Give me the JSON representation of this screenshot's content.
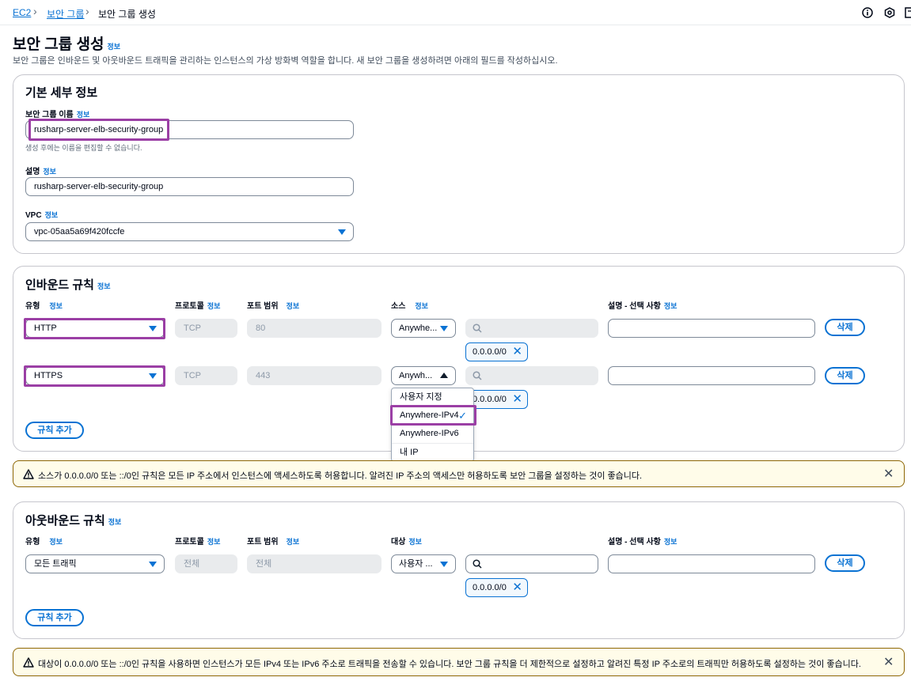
{
  "breadcrumb": {
    "root": "EC2",
    "parent": "보안 그룹",
    "current": "보안 그룹 생성"
  },
  "header": {
    "title": "보안 그룹 생성",
    "info": "정보",
    "description": "보안 그룹은 인바운드 및 아웃바운드 트래픽을 관리하는 인스턴스의 가상 방화벽 역할을 합니다. 새 보안 그룹을 생성하려면 아래의 필드를 작성하십시오."
  },
  "basic": {
    "title": "기본 세부 정보",
    "name_label": "보안 그룹 이름",
    "name_value": "rusharp-server-elb-security-group",
    "name_hint": "생성 후에는 이름을 편집할 수 없습니다.",
    "desc_label": "설명",
    "desc_value": "rusharp-server-elb-security-group",
    "vpc_label": "VPC",
    "vpc_value": "vpc-05aa5a69f420fccfe"
  },
  "inbound": {
    "title": "인바운드 규칙",
    "col_type": "유형",
    "col_protocol": "프로토콜",
    "col_port": "포트 범위",
    "col_source": "소스",
    "col_desc": "설명 - 선택 사항",
    "rows": [
      {
        "type": "HTTP",
        "protocol": "TCP",
        "port": "80",
        "source": "Anywhe...",
        "cidr": "0.0.0.0/0",
        "delete": "삭제"
      },
      {
        "type": "HTTPS",
        "protocol": "TCP",
        "port": "443",
        "source": "Anywh...",
        "cidr": "0.0.0.0/0",
        "delete": "삭제"
      }
    ],
    "add_rule": "규칙 추가",
    "dropdown": [
      "사용자 지정",
      "Anywhere-IPv4",
      "Anywhere-IPv6",
      "내 IP"
    ]
  },
  "inbound_warning": "소스가 0.0.0.0/0 또는 ::/0인 규칙은 모든 IP 주소에서 인스턴스에 액세스하도록 허용합니다. 알려진 IP 주소의 액세스만 허용하도록 보안 그룹을 설정하는 것이 좋습니다.",
  "outbound": {
    "title": "아웃바운드 규칙",
    "col_type": "유형",
    "col_protocol": "프로토콜",
    "col_port": "포트 범위",
    "col_dest": "대상",
    "col_desc": "설명 - 선택 사항",
    "row": {
      "type": "모든 트래픽",
      "protocol": "전체",
      "port": "전체",
      "dest": "사용자 ...",
      "cidr": "0.0.0.0/0",
      "delete": "삭제"
    },
    "add_rule": "규칙 추가"
  },
  "outbound_warning": "대상이 0.0.0.0/0 또는 ::/0인 규칙을 사용하면 인스턴스가 모든 IPv4 또는 IPv6 주소로 트래픽을 전송할 수 있습니다. 보안 그룹 규칙을 더 제한적으로 설정하고 알려진 특정 IP 주소로의 트래픽만 허용하도록 설정하는 것이 좋습니다.",
  "colors": {
    "link": "#0972d3",
    "highlight": "#9b3fa5",
    "warning_bg": "#fffce9"
  }
}
